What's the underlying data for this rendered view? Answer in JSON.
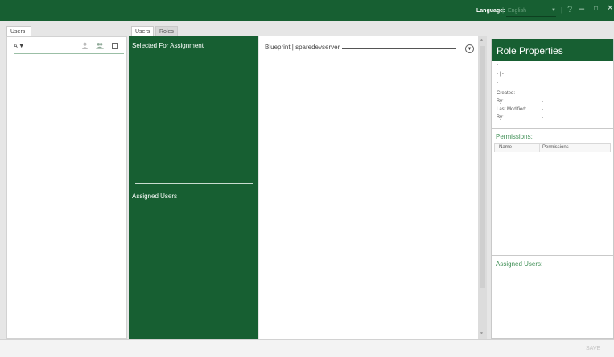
{
  "topbar": {
    "language_label": "Language:",
    "separator": "|",
    "language_value": "English",
    "dropdown_arrow": "▼",
    "help": "?",
    "minimize": "–",
    "maximize": "□",
    "close": "✕"
  },
  "left_panel": {
    "tab_label": "Users",
    "sort_label": "A ▼",
    "user_icon": "user-icon",
    "group_icon": "group-icon"
  },
  "middle_tabs": [
    {
      "label": "Users",
      "active": true
    },
    {
      "label": "Roles",
      "active": false
    }
  ],
  "green_panel": {
    "selected_title": "Selected For Assignment",
    "assigned_title": "Assigned Users"
  },
  "center": {
    "blueprint_label": "Blueprint | sparedevserver"
  },
  "role_properties": {
    "title": "Role Properties",
    "name": "-",
    "id_line": "- | -",
    "description": "-",
    "fields": [
      {
        "label": "Created:",
        "value": "-"
      },
      {
        "label": "By:",
        "value": "-"
      },
      {
        "label": "Last Modified:",
        "value": "-"
      },
      {
        "label": "By:",
        "value": "-"
      }
    ],
    "permissions_title": "Permissions:",
    "permissions_columns": [
      "Name",
      "Permissions"
    ],
    "assigned_users_title": "Assigned Users:"
  },
  "footer": {
    "save_label": "SAVE"
  },
  "colors": {
    "brand_green": "#175f32",
    "accent_green": "#3f8f55"
  }
}
